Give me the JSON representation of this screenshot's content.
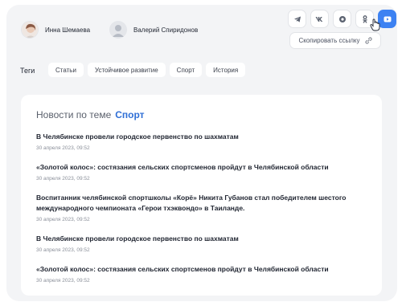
{
  "authors": [
    {
      "name": "Инна Шемаева"
    },
    {
      "name": "Валерий Спиридонов"
    }
  ],
  "share": {
    "buttons": [
      {
        "icon": "telegram-icon"
      },
      {
        "icon": "vk-icon"
      },
      {
        "icon": "mail-icon"
      },
      {
        "icon": "odnoklassniki-icon"
      },
      {
        "icon": "youtube-icon"
      }
    ],
    "copy_label": "Скопировать ссылку",
    "accent": "#3d82f2"
  },
  "tags": {
    "label": "Теги",
    "items": [
      "Статьи",
      "Устойчивое развитие",
      "Спорт",
      "История"
    ]
  },
  "card": {
    "title_prefix": "Новости по теме",
    "topic": "Спорт",
    "news": [
      {
        "title": "В Челябинске провели городское первенство по шахматам",
        "date": "30 апреля 2023, 09:52"
      },
      {
        "title": "«Золотой колос»: состязания сельских спортсменов пройдут в Челябинской области",
        "date": "30 апреля 2023, 09:52"
      },
      {
        "title": "Воспитанник челябинской спортшколы «Корё» Никита Губанов стал победителем шестого международного чемпионата «Герои тхэквондо» в Таиланде.",
        "date": "30 апреля 2023, 09:52"
      },
      {
        "title": "В Челябинске провели городское первенство по шахматам",
        "date": "30 апреля 2023, 09:52"
      },
      {
        "title": "«Золотой колос»: состязания сельских спортсменов пройдут в Челябинской области",
        "date": "30 апреля 2023, 09:52"
      }
    ]
  }
}
